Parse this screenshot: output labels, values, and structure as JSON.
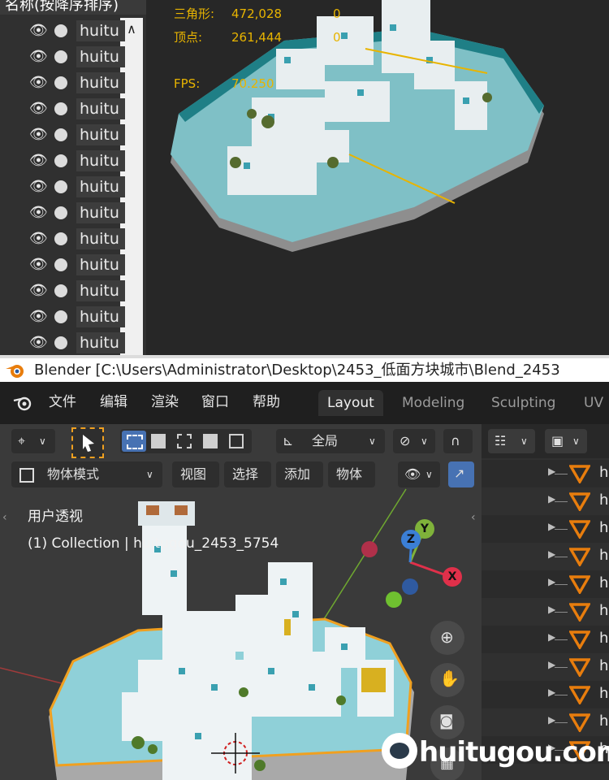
{
  "top_outliner": {
    "header": "名称(按降序排序)",
    "rows": [
      {
        "name": "huitu"
      },
      {
        "name": "huitu"
      },
      {
        "name": "huitu"
      },
      {
        "name": "huitu"
      },
      {
        "name": "huitu"
      },
      {
        "name": "huitu"
      },
      {
        "name": "huitu"
      },
      {
        "name": "huitu"
      },
      {
        "name": "huitu"
      },
      {
        "name": "huitu"
      },
      {
        "name": "huitu"
      },
      {
        "name": "huitu"
      },
      {
        "name": "huitu"
      }
    ]
  },
  "stats": {
    "triangles_label": "三角形:",
    "triangles_value": "472,028",
    "triangles_extra": "0",
    "vertices_label": "顶点:",
    "vertices_value": "261,444",
    "vertices_extra": "0",
    "fps_label": "FPS:",
    "fps_value": "70.250"
  },
  "window": {
    "title": "Blender [C:\\Users\\Administrator\\Desktop\\2453_低面方块城市\\Blend_2453"
  },
  "menu": {
    "file": "文件",
    "edit": "编辑",
    "render": "渲染",
    "window": "窗口",
    "help": "帮助"
  },
  "workspaces": [
    {
      "label": "Layout",
      "active": true
    },
    {
      "label": "Modeling",
      "active": false
    },
    {
      "label": "Sculpting",
      "active": false
    },
    {
      "label": "UV",
      "active": false
    }
  ],
  "viewport_header": {
    "global_label": "全局",
    "mode_label": "物体模式",
    "view": "视图",
    "select": "选择",
    "add": "添加",
    "object": "物体"
  },
  "viewport_overlay": {
    "view_name": "用户透视",
    "collection": "(1) Collection | huitugou_2453_5754"
  },
  "gizmo": {
    "x": "X",
    "y": "Y",
    "z": "Z"
  },
  "right_outliner": {
    "rows": [
      {
        "name": "hu"
      },
      {
        "name": "hu"
      },
      {
        "name": "hu"
      },
      {
        "name": "hu"
      },
      {
        "name": "hu"
      },
      {
        "name": "hu"
      },
      {
        "name": "hu"
      },
      {
        "name": "hu"
      },
      {
        "name": "hu"
      },
      {
        "name": "hu"
      },
      {
        "name": "hu"
      }
    ]
  },
  "watermark": "huitugou.com",
  "colors": {
    "accent_yellow": "#e8b400",
    "blender_orange": "#e87d0d",
    "active_blue": "#4772b3",
    "axis_x": "#e0304a",
    "axis_y": "#7fb23a",
    "axis_z": "#3b7fd6"
  }
}
